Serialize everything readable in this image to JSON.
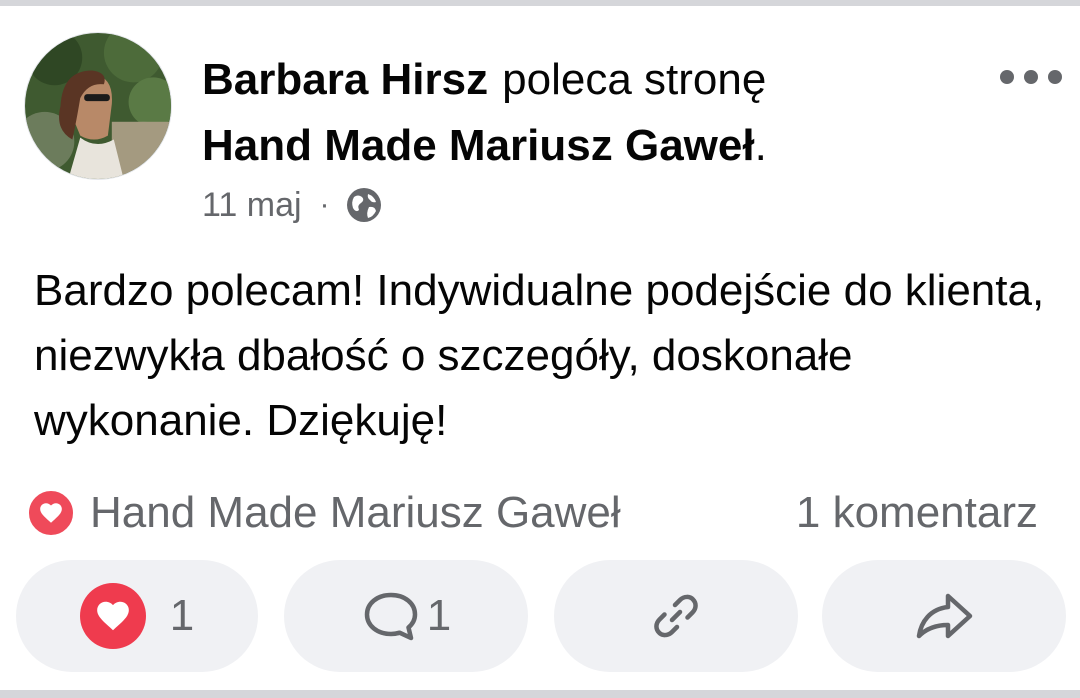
{
  "post": {
    "author": "Barbara Hirsz",
    "verb": "poleca stronę",
    "page_name": "Hand Made Mariusz Gaweł",
    "page_suffix": ".",
    "date": "11 maj",
    "separator": "·",
    "audience_icon": "globe-icon",
    "more_icon": "more-options-icon",
    "text": "Bardzo polecam! Indywidualne podejście do klienta, niezwykła dbałość o szczegóły, doskonałe wykonanie. Dziękuję!"
  },
  "reactions": {
    "icon": "heart-icon",
    "name": "Hand Made Mariusz Gaweł",
    "comments_label": "1 komentarz"
  },
  "actions": {
    "like_count": "1",
    "comment_count": "1",
    "like_icon": "heart-icon",
    "comment_icon": "comment-icon",
    "link_icon": "link-icon",
    "share_icon": "share-icon"
  },
  "colors": {
    "heart": "#ef3b4e",
    "secondary_text": "#65676b",
    "button_bg": "#f0f1f4"
  }
}
